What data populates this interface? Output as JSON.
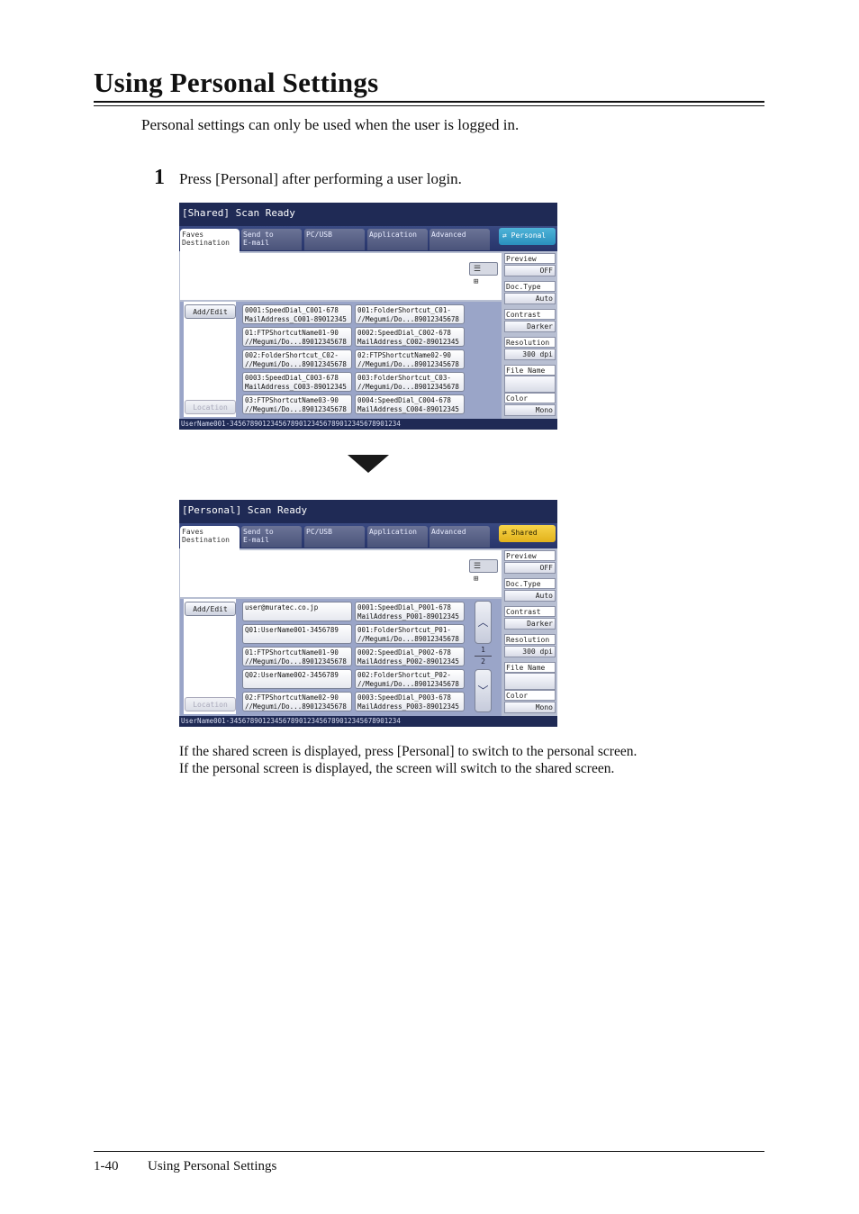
{
  "page": {
    "title": "Using Personal Settings",
    "intro": "Personal settings can only be used when the user is logged in.",
    "step_number": "1",
    "step_text": "Press [Personal] after performing a user login.",
    "note_line1": "If the shared screen is displayed, press [Personal] to switch to the personal screen.",
    "note_line2": "If the personal screen is displayed, the screen will switch to the shared screen.",
    "footer_page": "1-40",
    "footer_title": "Using Personal Settings"
  },
  "common": {
    "tab_faves_line1": "Faves",
    "tab_faves_line2": "Destination",
    "tab_send_line1": "Send to",
    "tab_send_line2": "E-mail",
    "tab_pcusb": "PC/USB",
    "tab_application": "Application",
    "tab_advanced": "Advanced",
    "view_toggle": "☰ ⊞",
    "add_edit": "Add/Edit",
    "location": "Location",
    "side": {
      "preview_label": "Preview",
      "preview_value": "OFF",
      "doctype_label": "Doc.Type",
      "doctype_value": "Auto",
      "contrast_label": "Contrast",
      "contrast_value": "Darker",
      "resolution_label": "Resolution",
      "resolution_value": "300 dpi",
      "filename_label": "File Name",
      "color_label": "Color",
      "color_value": "Mono"
    },
    "status": "UserName001-345678901234567890123456789012345678901234"
  },
  "screen1": {
    "title": "[Shared] Scan Ready",
    "switch_label": "⇄ Personal",
    "entries": [
      [
        "0001:SpeedDial_C001-678",
        "MailAddress_C001-89012345"
      ],
      [
        "001:FolderShortcut_C01-",
        "//Megumi/Do...89012345678"
      ],
      [
        "01:FTPShortcutName01-90",
        "//Megumi/Do...89012345678"
      ],
      [
        "0002:SpeedDial_C002-678",
        "MailAddress_C002-89012345"
      ],
      [
        "002:FolderShortcut_C02-",
        "//Megumi/Do...89012345678"
      ],
      [
        "02:FTPShortcutName02-90",
        "//Megumi/Do...89012345678"
      ],
      [
        "0003:SpeedDial_C003-678",
        "MailAddress_C003-89012345"
      ],
      [
        "003:FolderShortcut_C03-",
        "//Megumi/Do...89012345678"
      ],
      [
        "03:FTPShortcutName03-90",
        "//Megumi/Do...89012345678"
      ],
      [
        "0004:SpeedDial_C004-678",
        "MailAddress_C004-89012345"
      ]
    ]
  },
  "screen2": {
    "title": "[Personal] Scan Ready",
    "switch_label": "⇄ Shared",
    "entries": [
      [
        "user@muratec.co.jp",
        ""
      ],
      [
        "0001:SpeedDial_P001-678",
        "MailAddress_P001-89012345"
      ],
      [
        "Q01:UserName001-3456789",
        ""
      ],
      [
        "001:FolderShortcut_P01-",
        "//Megumi/Do...89012345678"
      ],
      [
        "01:FTPShortcutName01-90",
        "//Megumi/Do...89012345678"
      ],
      [
        "0002:SpeedDial_P002-678",
        "MailAddress_P002-89012345"
      ],
      [
        "Q02:UserName002-3456789",
        ""
      ],
      [
        "002:FolderShortcut_P02-",
        "//Megumi/Do...89012345678"
      ],
      [
        "02:FTPShortcutName02-90",
        "//Megumi/Do...89012345678"
      ],
      [
        "0003:SpeedDial_P003-678",
        "MailAddress_P003-89012345"
      ]
    ],
    "page_current": "1",
    "page_total": "2",
    "scroll_up": "︿",
    "scroll_down": "﹀"
  }
}
